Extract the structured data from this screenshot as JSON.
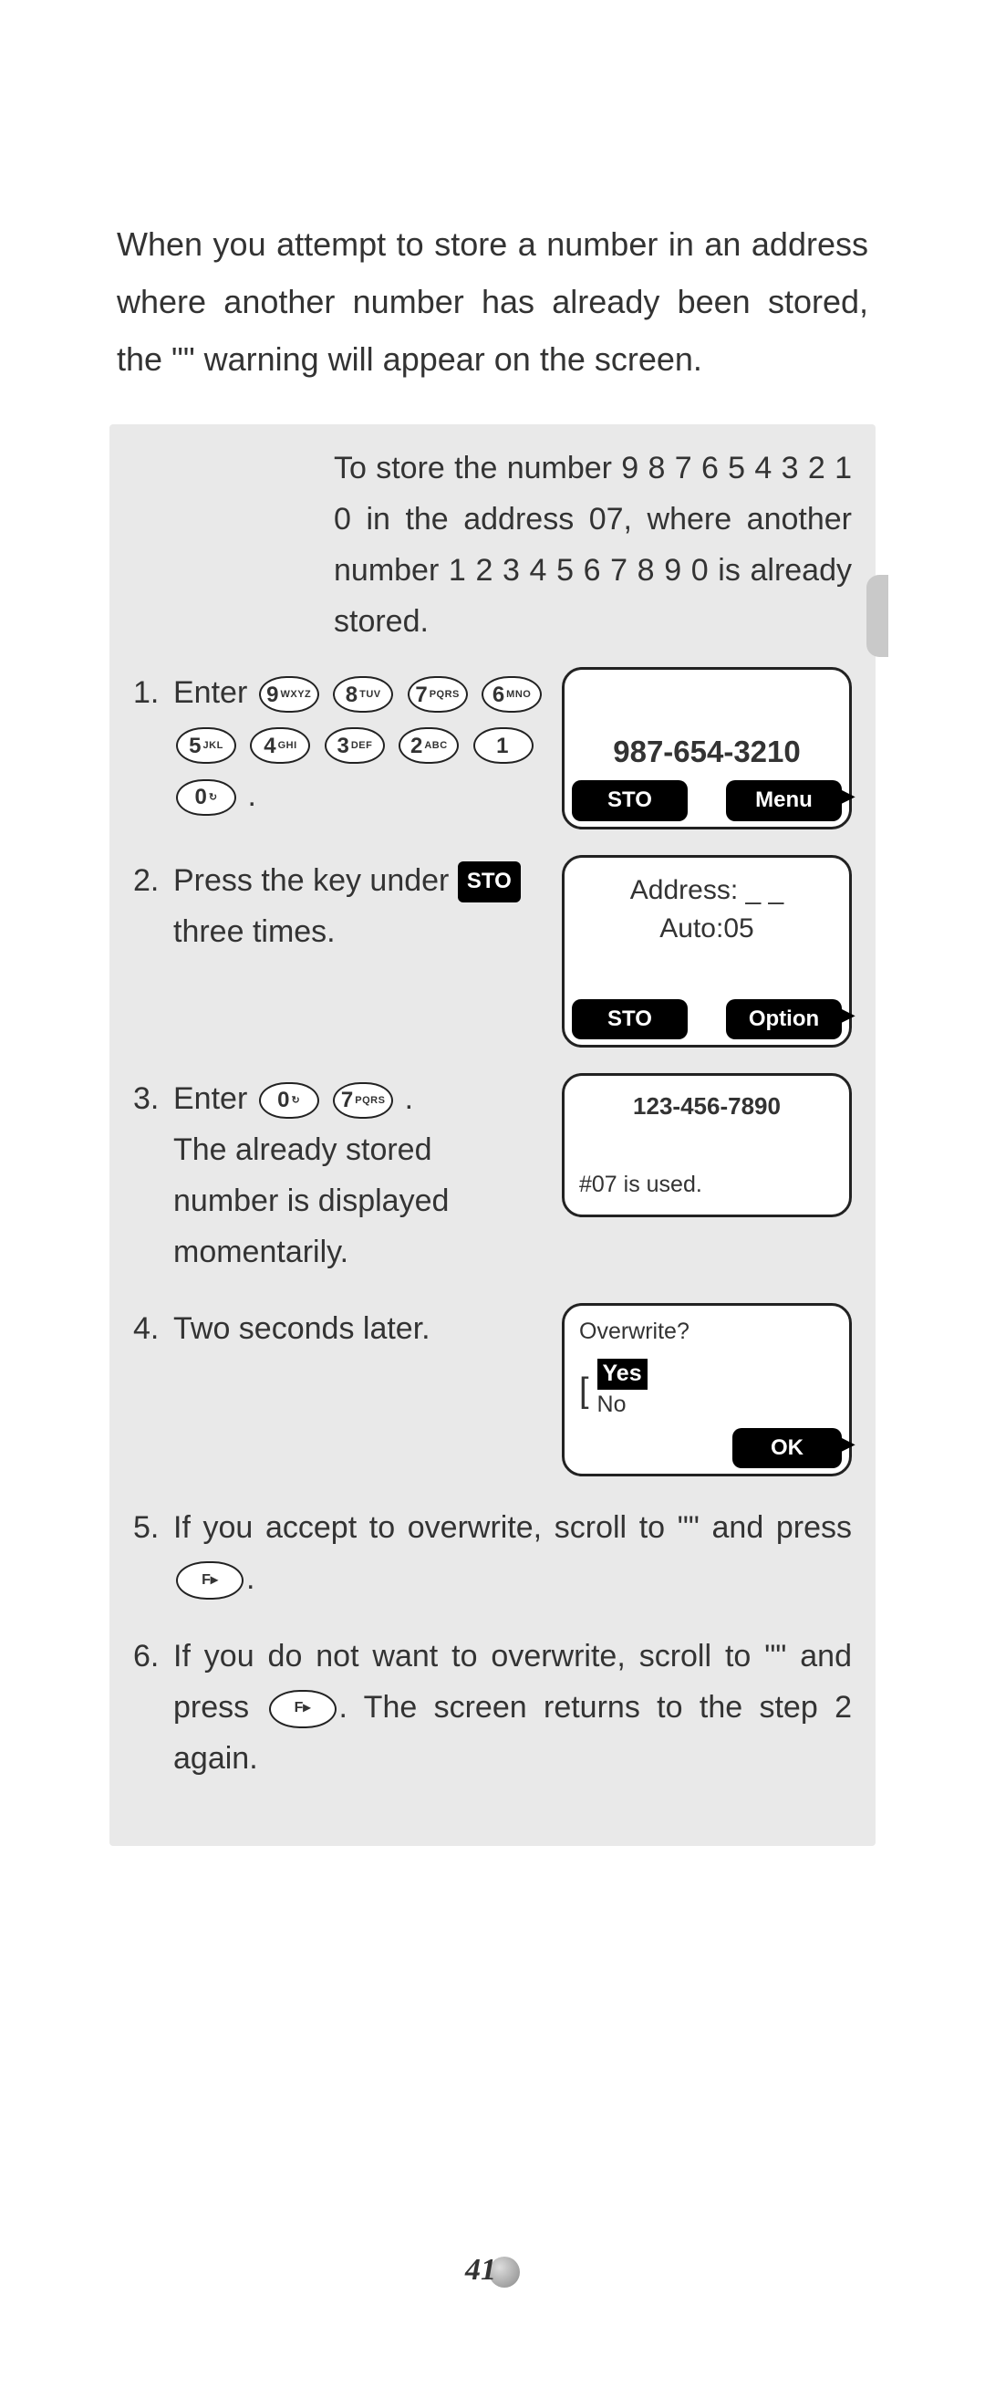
{
  "intro": {
    "p1_a": "When you attempt to store a number in an address where another number has already been stored, the \"",
    "warning_word": "",
    "p1_b": "\" warning will appear on the screen."
  },
  "example": {
    "label": "",
    "header": "To store the number 9 8 7 6 5 4 3 2 1 0 in the address 07, where another num­ber 1 2 3 4 5 6 7 8 9 0 is already stored."
  },
  "keys": [
    {
      "big": "9",
      "sm": "WXYZ"
    },
    {
      "big": "8",
      "sm": "TUV"
    },
    {
      "big": "7",
      "sm": "PQRS"
    },
    {
      "big": "6",
      "sm": "MNO"
    },
    {
      "big": "5",
      "sm": "JKL"
    },
    {
      "big": "4",
      "sm": "GHI"
    },
    {
      "big": "3",
      "sm": "DEF"
    },
    {
      "big": "2",
      "sm": "ABC"
    },
    {
      "big": "1",
      "sm": ""
    },
    {
      "big": "0",
      "sm": "↻"
    }
  ],
  "keys2": [
    {
      "big": "0",
      "sm": "↻"
    },
    {
      "big": "7",
      "sm": "PQRS"
    }
  ],
  "fkey": {
    "label": "F▸"
  },
  "sto_badge": "STO",
  "steps": {
    "s1_pre": "Enter ",
    "s1_post": ".",
    "s2_a": "Press the key under ",
    "s2_b": " three times.",
    "s3_a": "Enter ",
    "s3_b": ".",
    "s3_c": "The already stored number is displayed momentarily.",
    "s4": "Two seconds later.",
    "s5_a": "If you accept to overwrite, scroll to \"",
    "s5_yes": "",
    "s5_b": "\" and press ",
    "s5_c": ".",
    "s6_a": "If you do not want to overwrite, scroll to \"",
    "s6_no": "",
    "s6_b": "\" and press ",
    "s6_c": ". The screen returns to the step 2 again."
  },
  "screens": {
    "s1": {
      "phone": "987-654-3210",
      "left": "STO",
      "right": "Menu"
    },
    "s2": {
      "addr1": "Address:   _ _",
      "addr2": "Auto:05",
      "left": "STO",
      "right": "Option"
    },
    "s3": {
      "phone": "123-456-7890",
      "msg": "#07 is used."
    },
    "s4": {
      "q": "Overwrite?",
      "yes": "Yes",
      "no": "No",
      "right": "OK"
    }
  },
  "page_number": "41"
}
